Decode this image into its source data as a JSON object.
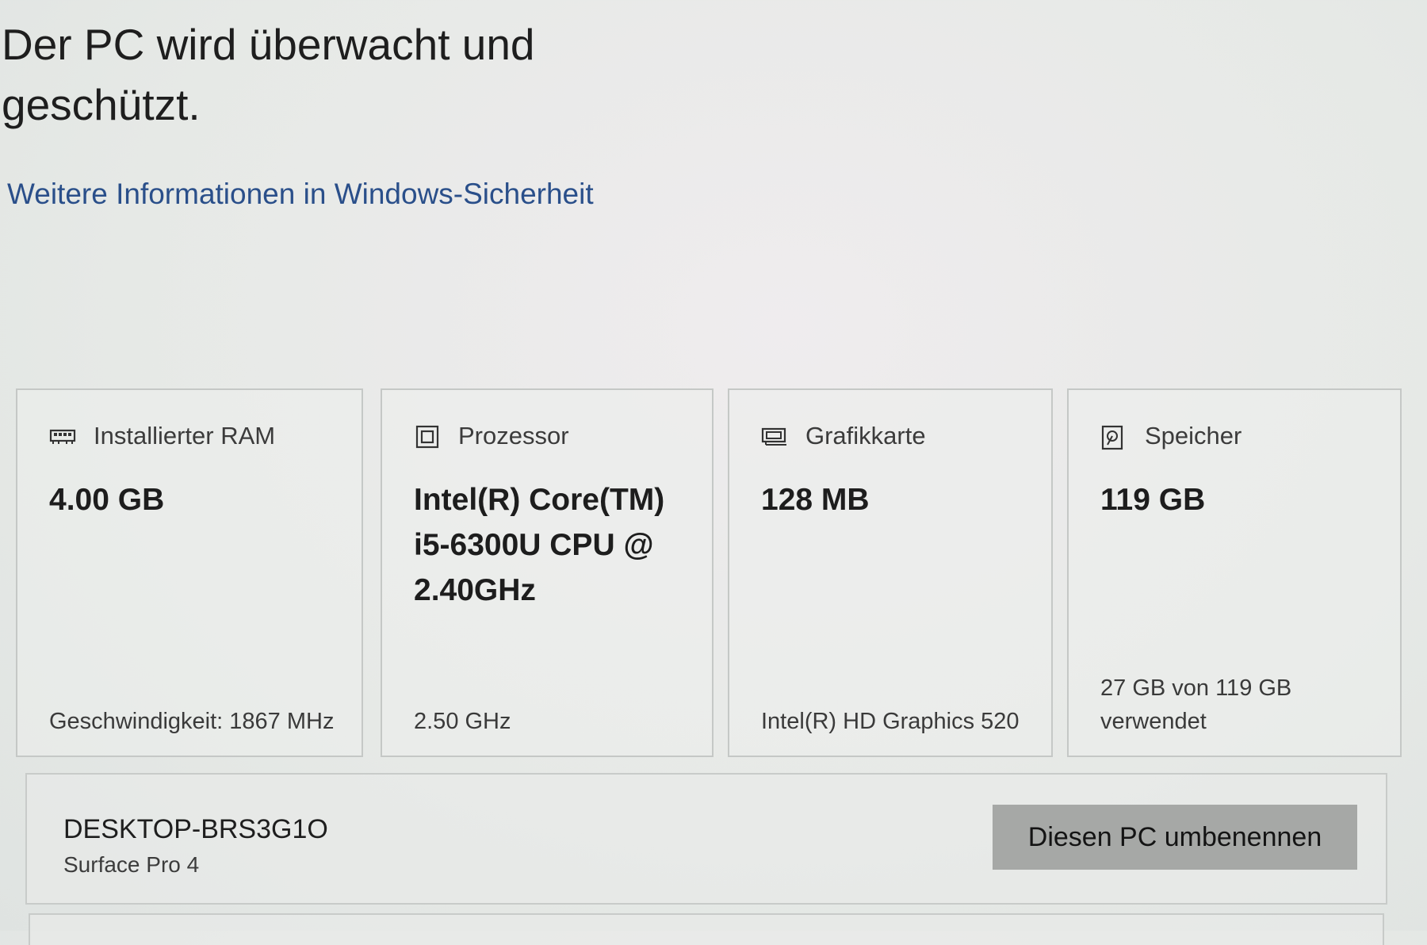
{
  "security": {
    "headline": "Der PC wird überwacht und geschützt.",
    "link_label": "Weitere Informationen in Windows-Sicherheit"
  },
  "cards": [
    {
      "icon": "ram-icon",
      "label": "Installierter RAM",
      "value": "4.00 GB",
      "detail": "Geschwindigkeit: 1867 MHz"
    },
    {
      "icon": "processor-icon",
      "label": "Prozessor",
      "value": "Intel(R) Core(TM) i5-6300U CPU @ 2.40GHz",
      "detail": "2.50 GHz"
    },
    {
      "icon": "graphics-card-icon",
      "label": "Grafikkarte",
      "value": "128 MB",
      "detail": "Intel(R) HD Graphics 520"
    },
    {
      "icon": "storage-icon",
      "label": "Speicher",
      "value": "119 GB",
      "detail": "27 GB von 119 GB verwendet"
    }
  ],
  "device": {
    "name": "DESKTOP-BRS3G1O",
    "model": "Surface Pro 4",
    "rename_button": "Diesen PC umbenennen"
  }
}
